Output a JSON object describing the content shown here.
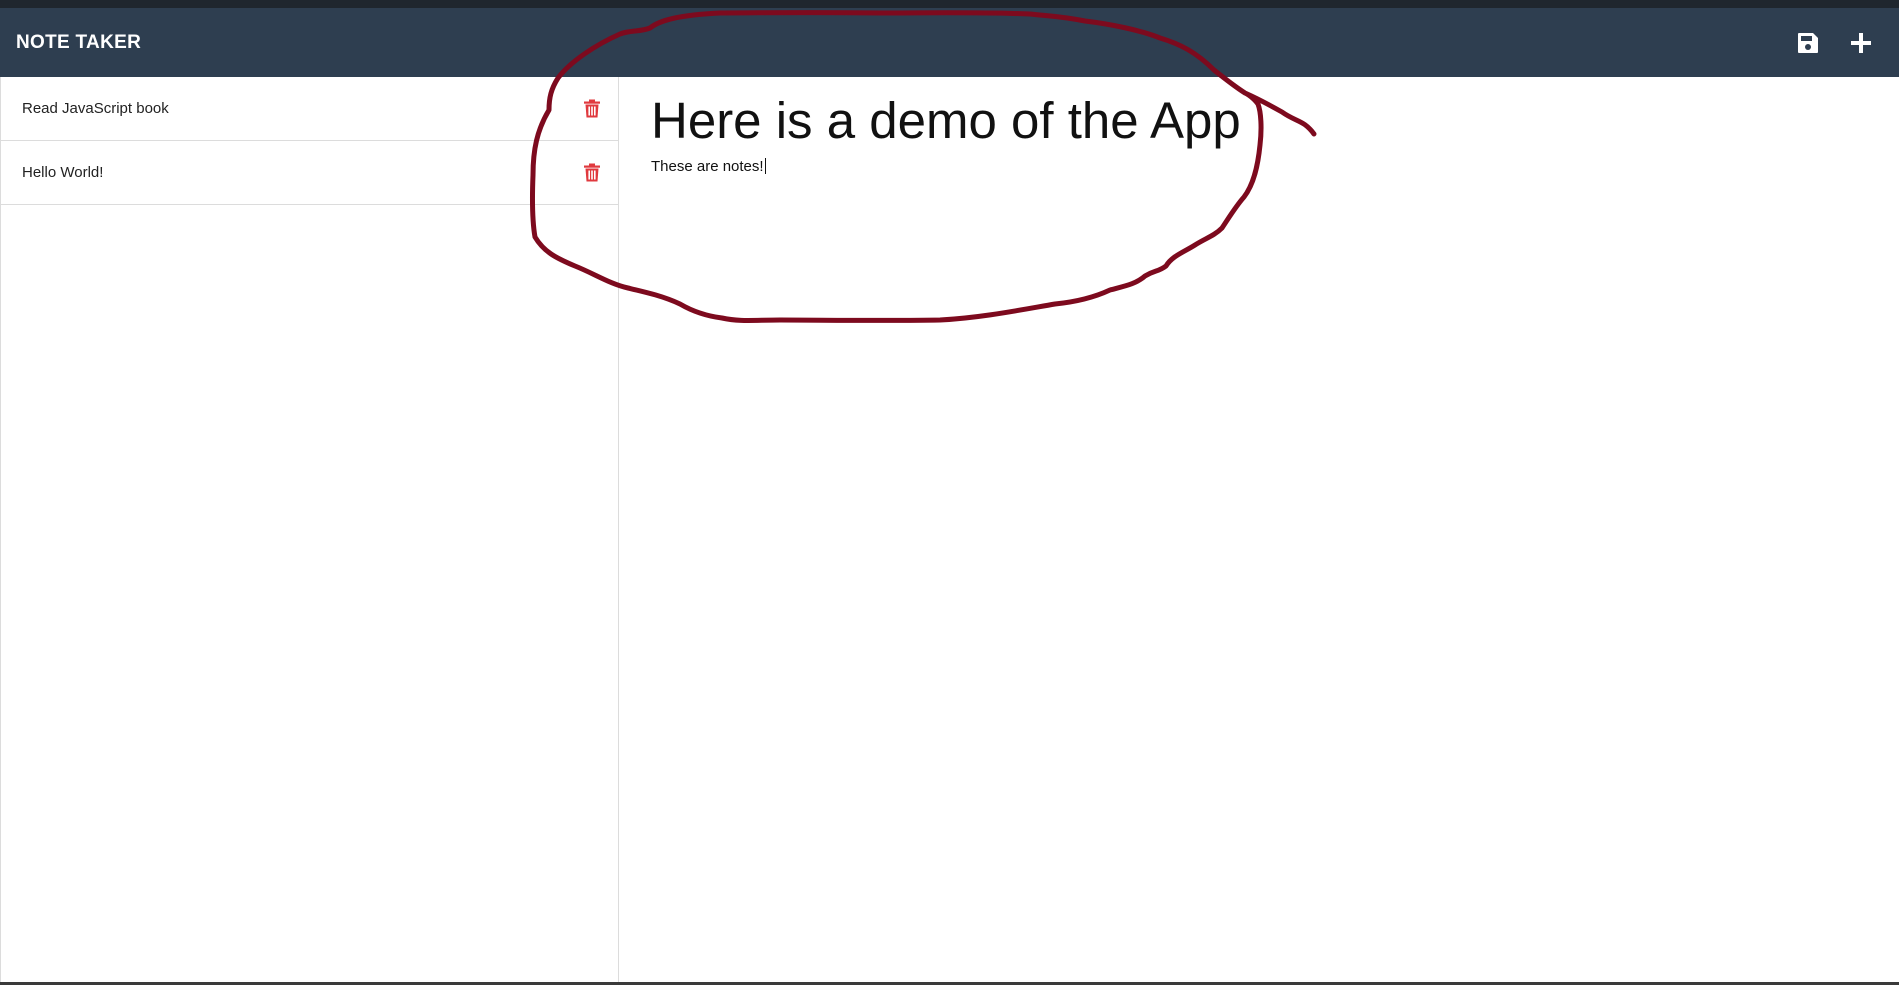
{
  "navbar": {
    "title": "NOTE TAKER",
    "save_icon": "floppy-disk-icon",
    "add_icon": "plus-icon",
    "background": "#2e3e50"
  },
  "sidebar": {
    "notes": [
      {
        "title": "Read JavaScript book",
        "delete_icon": "trash-icon"
      },
      {
        "title": "Hello World!",
        "delete_icon": "trash-icon"
      }
    ],
    "delete_color": "#e0393e"
  },
  "editor": {
    "title": "Here is a demo of the App",
    "text": "These are notes!"
  },
  "annotation": {
    "color": "#7d0a1e",
    "shape": "hand-drawn circle around note content"
  }
}
